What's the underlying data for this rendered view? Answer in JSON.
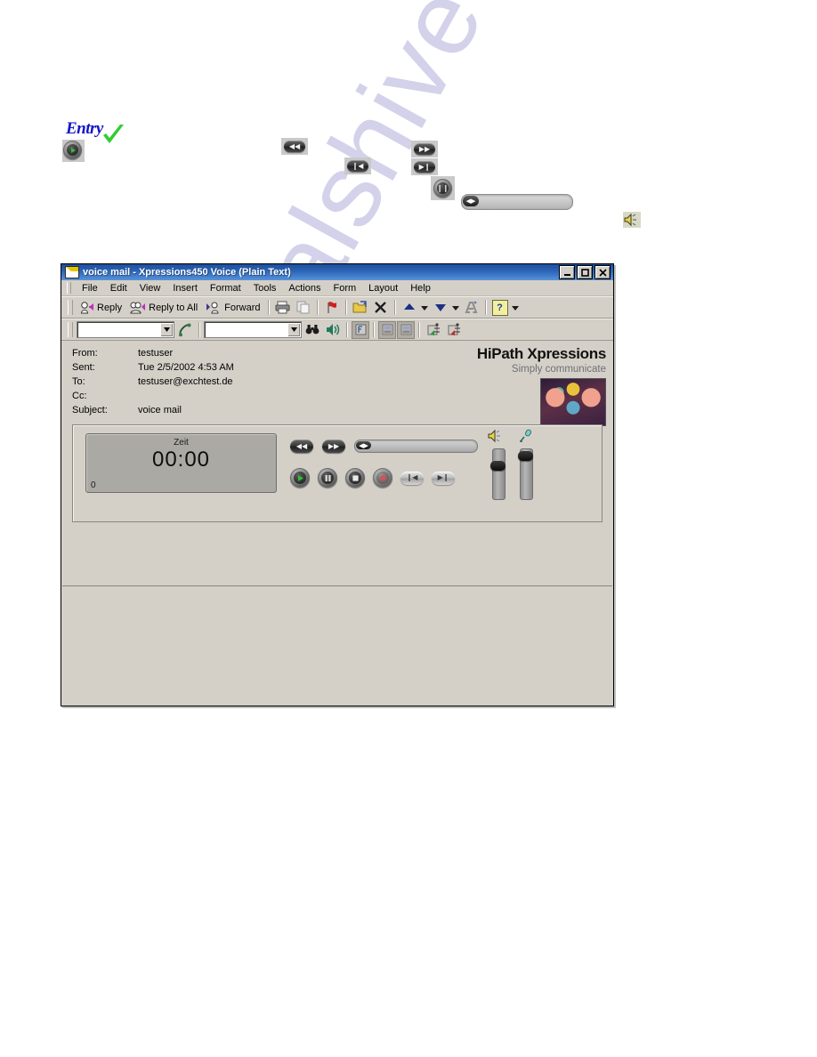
{
  "annotation": {
    "entry_label": "Entry",
    "icons": {
      "play": "play-icon",
      "check": "green-check-icon",
      "rewind": "rewind-icon",
      "pause_small": "pause-small-icon",
      "fast_forward": "fast-forward-icon",
      "skip_end": "skip-to-end-icon",
      "pause": "pause-icon",
      "speaker": "speaker-icon"
    },
    "slider_thumb": "◀▶"
  },
  "window": {
    "title": "voice mail - Xpressions450 Voice (Plain Text)",
    "icon": "envelope-icon",
    "controls": {
      "minimize": "_",
      "maximize": "❐",
      "close": "✕"
    }
  },
  "menu": {
    "items": [
      {
        "label": "File",
        "mnemonic": "F"
      },
      {
        "label": "Edit",
        "mnemonic": "E"
      },
      {
        "label": "View",
        "mnemonic": "V"
      },
      {
        "label": "Insert",
        "mnemonic": "I"
      },
      {
        "label": "Format",
        "mnemonic": "o"
      },
      {
        "label": "Tools",
        "mnemonic": "T"
      },
      {
        "label": "Actions",
        "mnemonic": "A"
      },
      {
        "label": "Form",
        "mnemonic": "r"
      },
      {
        "label": "Layout",
        "mnemonic": "L"
      },
      {
        "label": "Help",
        "mnemonic": "H"
      }
    ]
  },
  "toolbar1": {
    "reply": "Reply",
    "reply_all": "Reply to All",
    "forward": "Forward",
    "print_icon": "printer-icon",
    "copy_icon": "copy-icon",
    "flag_icon": "flag-icon",
    "move_icon": "move-to-folder-icon",
    "delete_icon": "delete-x-icon",
    "prev_icon": "previous-item-icon",
    "next_icon": "next-item-icon",
    "addressbook_icon": "find-contact-icon",
    "help_icon": "help-question-icon",
    "dropdown_arrow": "▾"
  },
  "toolbar2": {
    "combo1_value": "",
    "combo1_placeholder": "",
    "phone_icon": "phone-handset-icon",
    "combo2_value": "",
    "combo2_placeholder": "",
    "find_icon": "binoculars-icon",
    "speaker_icon": "speaker-icon",
    "voice_icon": "voice-note-icon",
    "fax1_icon": "fax-page-icon",
    "fax2_icon": "fax-page-2-icon",
    "import_icon": "import-green-icon",
    "export_icon": "export-red-icon",
    "dropdown_arrow": "▾"
  },
  "message": {
    "fields": [
      {
        "label": "From:",
        "value": "testuser"
      },
      {
        "label": "Sent:",
        "value": "Tue 2/5/2002 4:53 AM"
      },
      {
        "label": "To:",
        "value": "testuser@exchtest.de"
      },
      {
        "label": "Cc:",
        "value": ""
      },
      {
        "label": "Subject:",
        "value": "voice mail"
      }
    ],
    "brand_title": "HiPath Xpressions",
    "brand_tagline": "Simply communicate",
    "brand_image": "hipath-face-artwork"
  },
  "player": {
    "time_label": "Zeit",
    "time_value": "00:00",
    "counter": "0",
    "seek_thumb": "◀▶",
    "buttons": {
      "rewind": "rewind-button",
      "fast_forward": "fast-forward-button",
      "play": "play-button",
      "pause": "pause-button",
      "stop": "stop-button",
      "record": "record-button",
      "skip_start": "skip-to-start-button",
      "skip_end": "skip-to-end-button"
    },
    "volume": {
      "icon": "speaker-icon",
      "label": "volume-slider",
      "position_pct": 28
    },
    "microphone": {
      "icon": "microphone-icon",
      "label": "microphone-slider",
      "position_pct": 10
    }
  },
  "watermark": {
    "text": "manualshive"
  },
  "colors": {
    "titlebar": "#1d4f9b",
    "window_face": "#d4d0c8",
    "entry_blue": "#1414c8",
    "check_green": "#2fcd2f",
    "record_red": "#d4484a",
    "play_green": "#2fbf2f",
    "watermark": "#b9b8de"
  }
}
